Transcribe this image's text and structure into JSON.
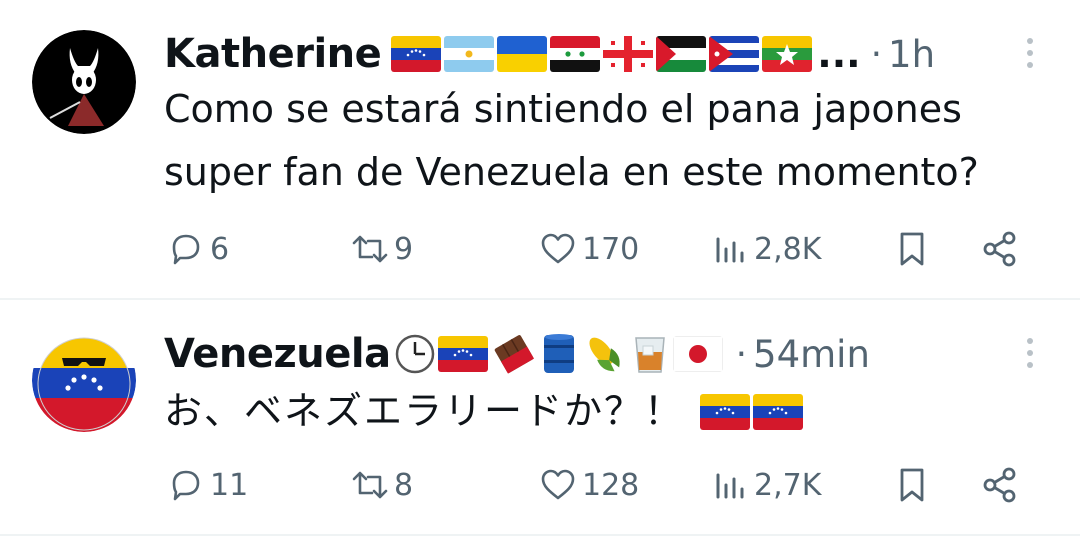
{
  "tweets": [
    {
      "author": "Katherine",
      "flags": [
        "venezuela-flag",
        "argentina-flag",
        "ukraine-flag",
        "syria-flag",
        "georgia-flag",
        "palestine-flag",
        "cuba-flag",
        "myanmar-flag"
      ],
      "ellipsis": "...",
      "separator": "·",
      "time": "1h",
      "text_line1": "Como se estará sintiendo el pana japones",
      "text_line2": "super fan de Venezuela en este momento?",
      "replies": "6",
      "reposts": "9",
      "likes": "170",
      "views": "2,8K"
    },
    {
      "author": "Venezuela",
      "name_emojis": [
        "clock-emoji",
        "venezuela-flag",
        "chocolate-emoji",
        "oil-drum-emoji",
        "corn-emoji",
        "whisky-emoji",
        "japan-flag"
      ],
      "separator": "·",
      "time": "54min",
      "text": "お、ベネズエラリードか？！",
      "text_flags": [
        "venezuela-flag",
        "venezuela-flag"
      ],
      "replies": "11",
      "reposts": "8",
      "likes": "128",
      "views": "2,7K"
    }
  ],
  "colors": {
    "text": "#0f1419",
    "muted": "#536471",
    "divider": "#eff3f4"
  }
}
